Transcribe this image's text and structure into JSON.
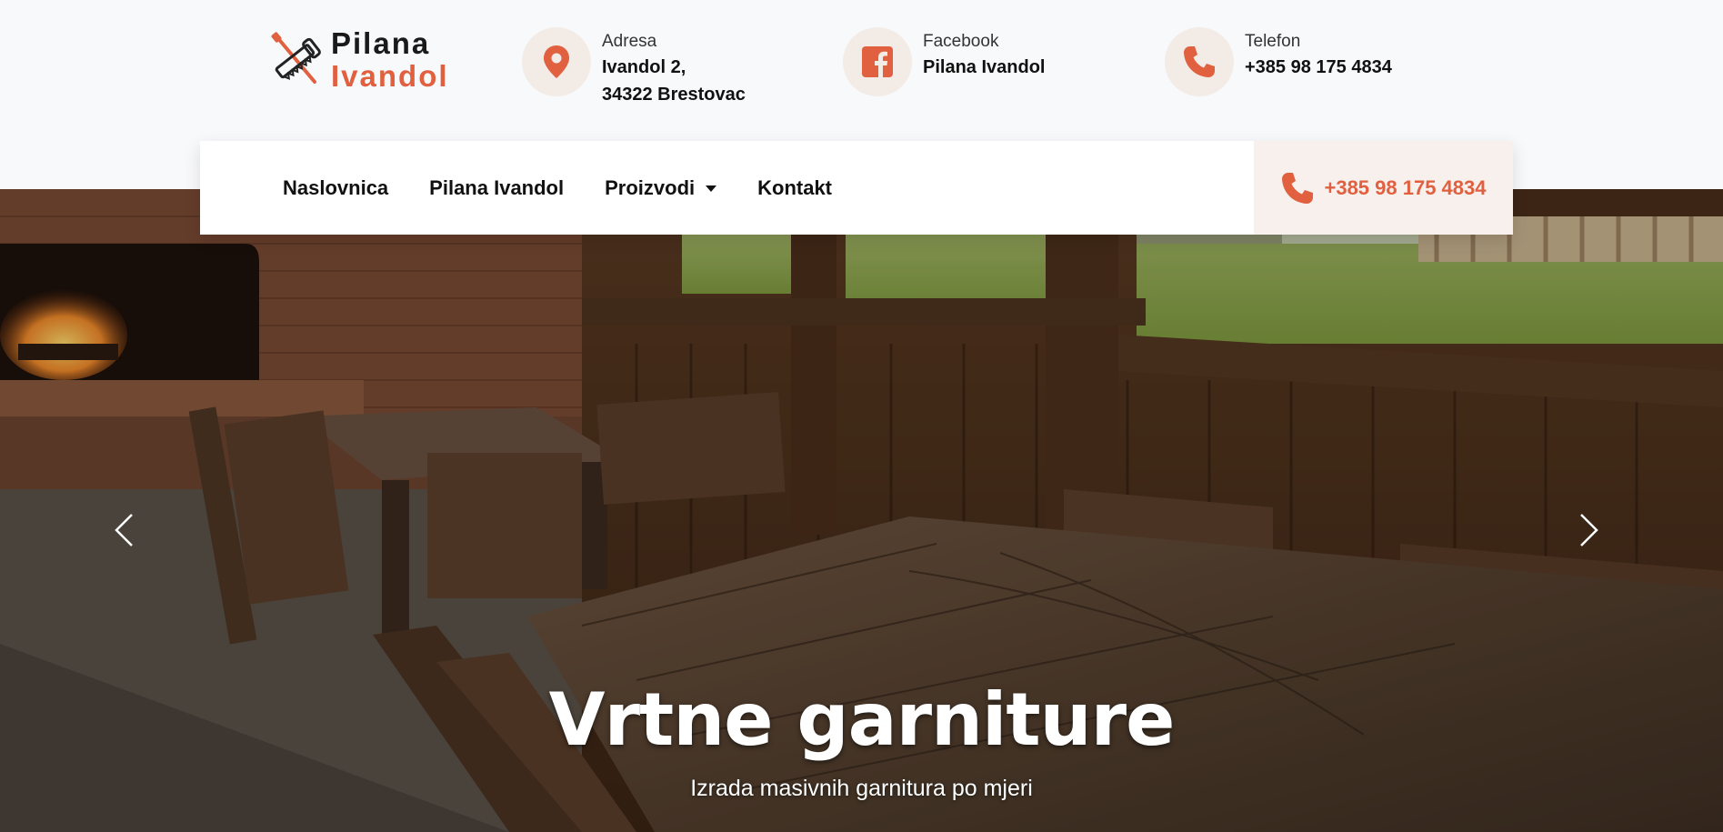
{
  "brand": {
    "line1": "Pilana",
    "line2": "Ivandol"
  },
  "info": {
    "address": {
      "label": "Adresa",
      "line1": "Ivandol 2,",
      "line2": "34322 Brestovac",
      "icon": "map-marker-icon"
    },
    "facebook": {
      "label": "Facebook",
      "value": "Pilana Ivandol",
      "icon": "facebook-icon"
    },
    "phone": {
      "label": "Telefon",
      "value": "+385 98 175 4834",
      "icon": "phone-icon"
    }
  },
  "nav": {
    "items": [
      {
        "label": "Naslovnica"
      },
      {
        "label": "Pilana Ivandol"
      },
      {
        "label": "Proizvodi"
      },
      {
        "label": "Kontakt"
      }
    ],
    "phone": "+385 98 175 4834"
  },
  "hero": {
    "title": "Vrtne garniture",
    "subtitle": "Izrada masivnih garnitura po mjeri"
  },
  "colors": {
    "accent": "#e0603f",
    "icon_bg": "#f3ebe6",
    "phone_bg": "#f7f0ed"
  }
}
